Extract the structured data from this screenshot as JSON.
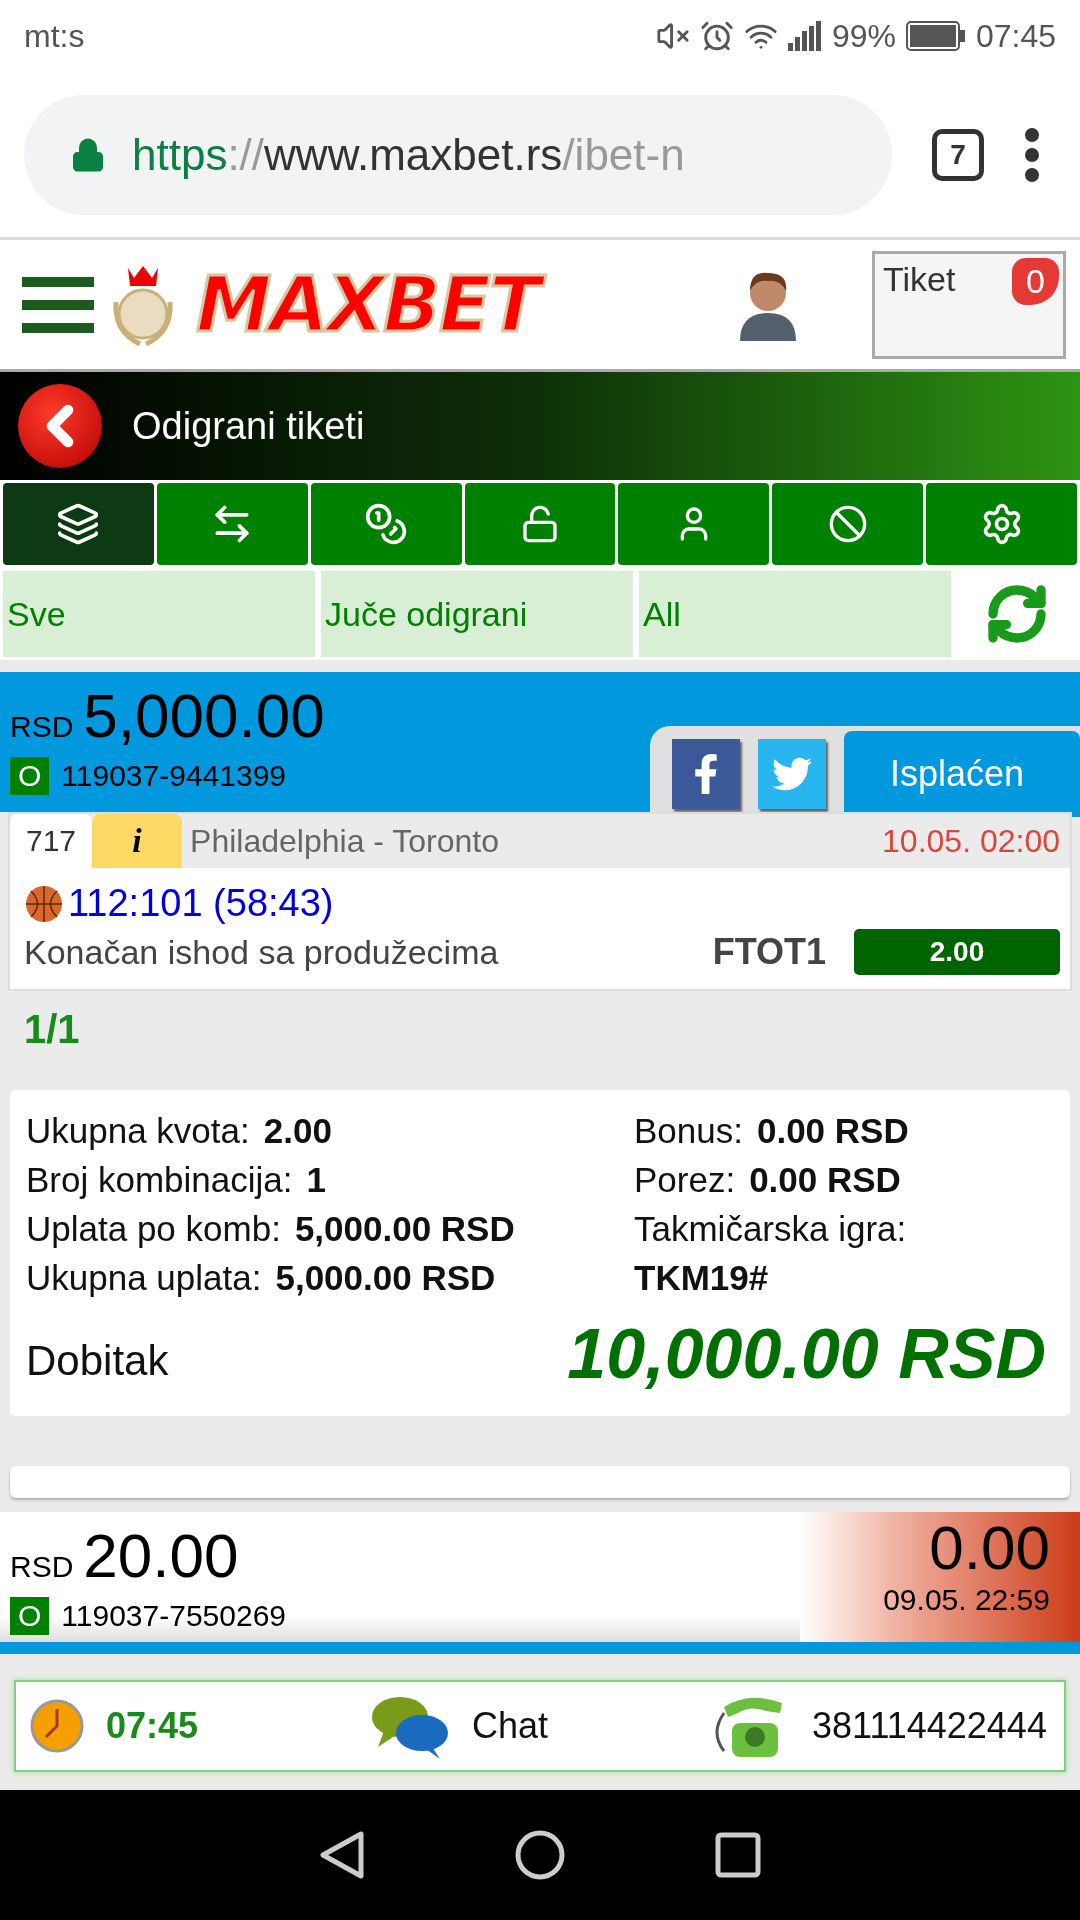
{
  "status_bar": {
    "carrier": "mt:s",
    "battery": "99%",
    "time": "07:45"
  },
  "browser": {
    "scheme": "https",
    "separator": "://",
    "host": "www.maxbet.rs",
    "path": "/ibet-n",
    "tab_count": "7"
  },
  "header": {
    "logo": "MAXBET",
    "ticket_label": "Tiket",
    "ticket_count": "0"
  },
  "title": "Odigrani tiketi",
  "icon_tabs": [
    {
      "kind": "stack",
      "selected": true
    },
    {
      "kind": "transfer",
      "selected": false
    },
    {
      "kind": "coins",
      "selected": false
    },
    {
      "kind": "unlock",
      "selected": false
    },
    {
      "kind": "user",
      "selected": false
    },
    {
      "kind": "block",
      "selected": false
    },
    {
      "kind": "gear",
      "selected": false
    }
  ],
  "filters": [
    "Sve",
    "Juče odigrani",
    "All"
  ],
  "ticket": {
    "currency": "RSD",
    "amount": "5,000.00",
    "code": "O",
    "number": "119037-9441399",
    "status": "Isplaćen",
    "match": {
      "number": "717",
      "info": "i",
      "name": "Philadelphia - Toronto",
      "datetime": "10.05. 02:00",
      "score": "112:101 (58:43)",
      "market": "Konačan ishod sa produžecima",
      "pick": "FTOT1",
      "odds": "2.00"
    },
    "count": "1/1",
    "summary_left": [
      {
        "label": "Ukupna kvota:",
        "value": "2.00"
      },
      {
        "label": "Broj kombinacija:",
        "value": "1"
      },
      {
        "label": "Uplata po komb:",
        "value": "5,000.00 RSD"
      },
      {
        "label": "Ukupna uplata:",
        "value": "5,000.00 RSD"
      }
    ],
    "summary_right": [
      {
        "kind": "inline",
        "label": "Bonus:",
        "value": "0.00 RSD"
      },
      {
        "kind": "inline",
        "label": "Porez:",
        "value": "0.00 RSD"
      },
      {
        "kind": "stacked",
        "label": "Takmičarska igra:",
        "value": "TKM19#"
      }
    ],
    "win_label": "Dobitak",
    "win": "10,000.00 RSD"
  },
  "next_ticket": {
    "currency": "RSD",
    "amount": "20.00",
    "code": "O",
    "number": "119037-7550269",
    "payout": "0.00",
    "datetime": "09.05. 22:59"
  },
  "footer": {
    "time": "07:45",
    "chat": "Chat",
    "phone": "381114422444"
  }
}
